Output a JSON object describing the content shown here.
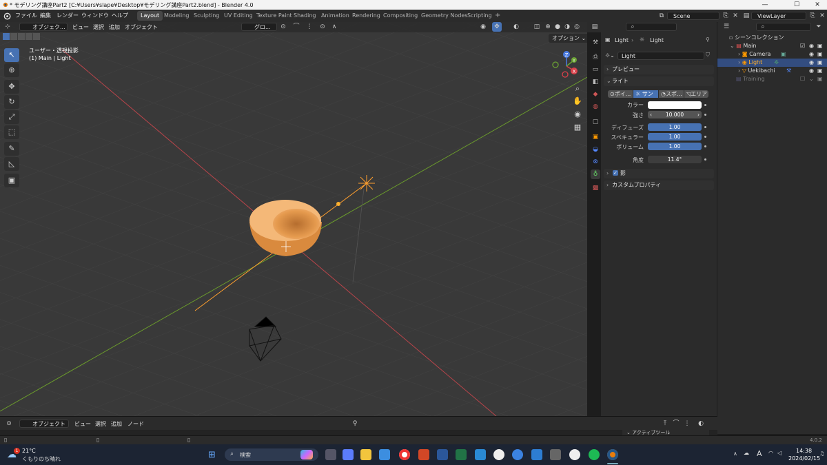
{
  "window": {
    "title": "* モデリング講座Part2 [C:¥Users¥slape¥Desktop¥モデリング講座Part2.blend] - Blender 4.0",
    "minimize": "—",
    "maximize": "☐",
    "close": "✕"
  },
  "menus": [
    "ファイル",
    "編集",
    "レンダー",
    "ウィンドウ",
    "ヘルプ"
  ],
  "workspaces": [
    "Layout",
    "Modeling",
    "Sculpting",
    "UV Editing",
    "Texture Paint",
    "Shading",
    "Animation",
    "Rendering",
    "Compositing",
    "Geometry Nodes",
    "Scripting"
  ],
  "workspace_add": "+",
  "scene": {
    "name": "Scene",
    "view_layer": "ViewLayer"
  },
  "viewport": {
    "mode": "オブジェク...",
    "menus": [
      "ビュー",
      "選択",
      "追加",
      "オブジェクト"
    ],
    "orientation": "グロ...",
    "options": "オプション",
    "view_name": "ユーザー・透視投影",
    "context": "(1) Main | Light",
    "gizmo_labels": [
      "Z",
      "X",
      "Y"
    ]
  },
  "properties": {
    "breadcrumb": [
      "Light",
      "Light"
    ],
    "datablock": "Light",
    "panels": {
      "preview": "プレビュー",
      "light": "ライト",
      "shadow": "影",
      "custom": "カスタムプロパティ"
    },
    "light_types": [
      "ポイ...",
      "サン",
      "スポ...",
      "エリア"
    ],
    "active_type": "サン",
    "color_label": "カラー",
    "strength_label": "強さ",
    "strength": "10.000",
    "diffuse_label": "ディフューズ",
    "diffuse": "1.00",
    "specular_label": "スペキュラー",
    "specular": "1.00",
    "volume_label": "ボリューム",
    "volume": "1.00",
    "angle_label": "角度",
    "angle": "11.4°"
  },
  "outliner": {
    "root": "シーンコレクション",
    "items": [
      {
        "name": "Main"
      },
      {
        "name": "Camera"
      },
      {
        "name": "Light"
      },
      {
        "name": "Uekibachi"
      },
      {
        "name": "Training"
      }
    ]
  },
  "timeline": {
    "menus": [
      "オブジェクト",
      "ビュー",
      "選択",
      "追加",
      "ノード"
    ],
    "active_tool": "アクティブツール"
  },
  "status": {
    "version": "4.0.2"
  },
  "taskbar": {
    "temp": "21°C",
    "weather": "くもりのち晴れ",
    "search": "検索",
    "time": "14:38",
    "date": "2024/02/15",
    "ime": "A",
    "badge": "1"
  },
  "colors": {
    "accent": "#4772b3",
    "orange": "#ff9f2e",
    "red_axis": "#b8444a",
    "green_axis": "#6a9a2c"
  }
}
